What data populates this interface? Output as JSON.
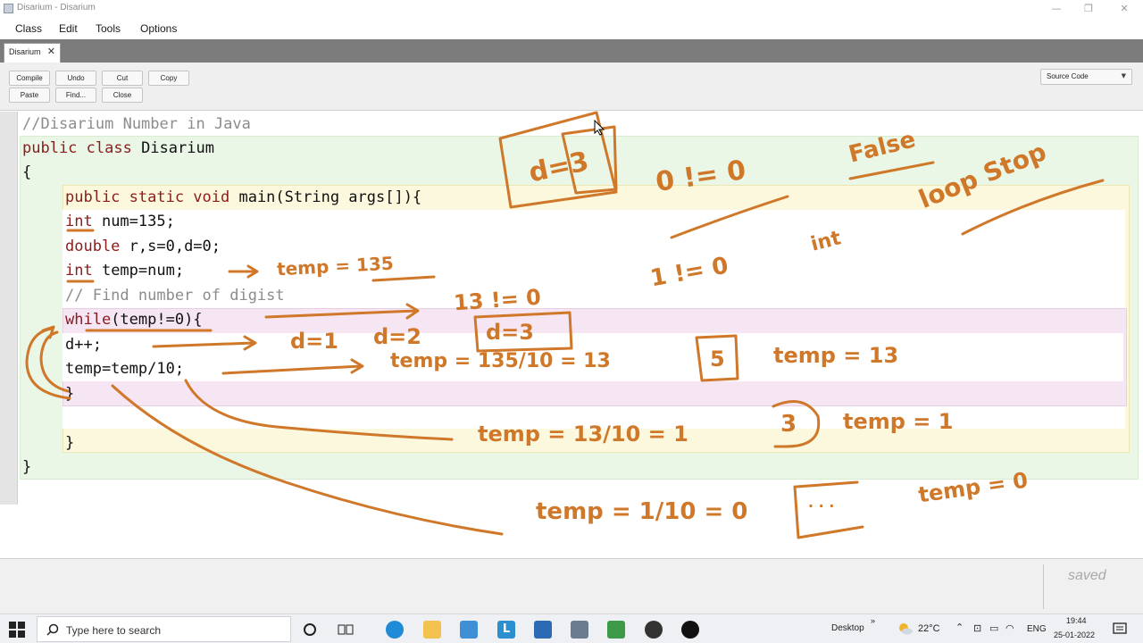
{
  "window": {
    "title": "Disarium - Disarium"
  },
  "menu": [
    "Class",
    "Edit",
    "Tools",
    "Options"
  ],
  "tab": {
    "label": "Disarium",
    "close": "✕"
  },
  "toolbar": {
    "row1": [
      "Compile",
      "Undo",
      "Cut",
      "Copy"
    ],
    "row2": [
      "Paste",
      "Find...",
      "Close"
    ],
    "view_select": "Source Code"
  },
  "code": {
    "line1": "//Disarium Number in Java",
    "line2_kw": "public class",
    "line2_rest": " Disarium",
    "line3": "{",
    "line4_kw": "public static void",
    "line4_rest": " main(String args[]){",
    "line5_kw": "int",
    "line5_rest": " num=135;",
    "line6_kw": "double",
    "line6_rest": " r,s=0,d=0;",
    "line7_kw": "int",
    "line7_rest": " temp=num;",
    "line8": "// Find number of digist",
    "line9_kw": "while",
    "line9_rest": "(temp!=0){",
    "line10": "d++;",
    "line11": "temp=temp/10;",
    "line12": "}",
    "line13": "}",
    "line14": "}"
  },
  "annotations": {
    "d3_top": "d=3",
    "not_zero": "0 != 0",
    "false": "False",
    "loop_stop": "loop Stop",
    "int_word": "int",
    "temp135": "temp = 135",
    "n1_zero": "1 != 0",
    "n13_zero": "13 != 0",
    "d_seq1": "d=1",
    "d_seq2": "d=2",
    "d_seq3": "d=3",
    "calc1": "temp = 135/10 = 13",
    "calc1_box": "5",
    "res1": "temp = 13",
    "calc2": "temp = 13/10 = 1",
    "calc2_box": "3",
    "res2": "temp = 1",
    "calc3": "temp = 1/10 = 0",
    "calc3_box": ". . .",
    "res3": "temp = 0"
  },
  "status": {
    "text": "saved"
  },
  "taskbar": {
    "search_placeholder": "Type here to search",
    "desktop_label": "Desktop",
    "temperature": "22°C",
    "language": "ENG",
    "time": "19:44",
    "date": "25-01-2022"
  },
  "colors": {
    "ink": "#d0782a",
    "keyword": "#8b1c1c",
    "comment": "#8c8c8c"
  }
}
